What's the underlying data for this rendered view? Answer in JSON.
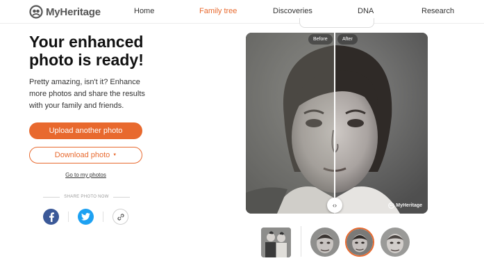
{
  "brand": {
    "name": "MyHeritage",
    "accent_color": "#e8692e"
  },
  "nav": {
    "items": [
      {
        "label": "Home",
        "active": false
      },
      {
        "label": "Family tree",
        "active": true
      },
      {
        "label": "Discoveries",
        "active": false
      },
      {
        "label": "DNA",
        "active": false
      },
      {
        "label": "Research",
        "active": false
      }
    ]
  },
  "result": {
    "headline": "Your enhanced photo is ready!",
    "subtext": "Pretty amazing, isn't it? Enhance more photos and share the results with your family and friends.",
    "upload_button": "Upload another photo",
    "download_button": "Download photo",
    "goto_link": "Go to my photos",
    "share_label": "SHARE PHOTO NOW"
  },
  "share": {
    "icons": [
      "facebook-icon",
      "twitter-icon",
      "link-icon"
    ],
    "facebook_color": "#3b5998",
    "twitter_color": "#1da1f2"
  },
  "viewer": {
    "before_label": "Before",
    "after_label": "After",
    "watermark": "MyHeritage",
    "handle_icon": "compare-handle-icon"
  },
  "thumbnails": {
    "count": 4,
    "selected_index": 2
  }
}
